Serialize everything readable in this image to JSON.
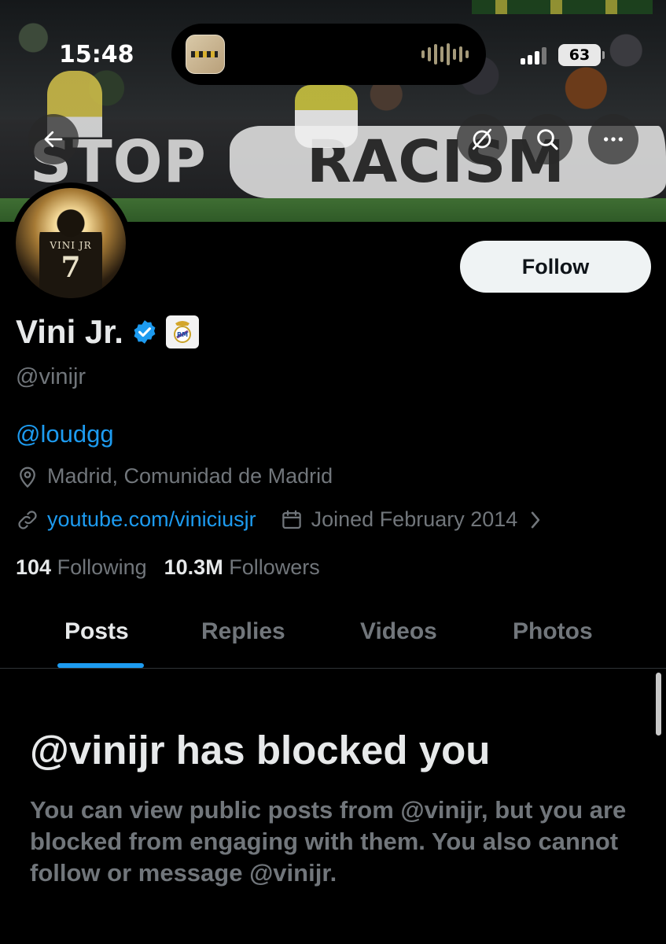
{
  "status_bar": {
    "time": "15:48",
    "battery": "63"
  },
  "banner": {
    "stop_text": "STOP",
    "racism_text": "RACISM"
  },
  "avatar": {
    "jersey_name": "VINI JR",
    "jersey_number": "7"
  },
  "profile": {
    "display_name": "Vini Jr.",
    "handle": "@vinijr",
    "bio": "@loudgg",
    "location": "Madrid, Comunidad de Madrid",
    "website": "youtube.com/viniciusjr",
    "joined": "Joined February 2014",
    "follow_label": "Follow",
    "following_count": "104",
    "following_label": "Following",
    "followers_count": "10.3M",
    "followers_label": "Followers"
  },
  "tabs": [
    {
      "label": "Posts",
      "active": true
    },
    {
      "label": "Replies",
      "active": false
    },
    {
      "label": "Videos",
      "active": false
    },
    {
      "label": "Photos",
      "active": false
    }
  ],
  "blocked": {
    "title": "@vinijr has blocked you",
    "body": "You can view public posts from @vinijr, but you are blocked from engaging with them. You also cannot follow or message @vinijr."
  },
  "colors": {
    "background": "#000000",
    "accent": "#1d9bf0",
    "muted": "#71767b",
    "text": "#e7e9ea",
    "follow_bg": "#eff3f4"
  },
  "icons": [
    "back-arrow-icon",
    "grok-icon",
    "search-icon",
    "more-icon",
    "verified-badge-icon",
    "real-madrid-badge-icon",
    "location-icon",
    "link-icon",
    "calendar-icon",
    "chevron-right-icon"
  ]
}
